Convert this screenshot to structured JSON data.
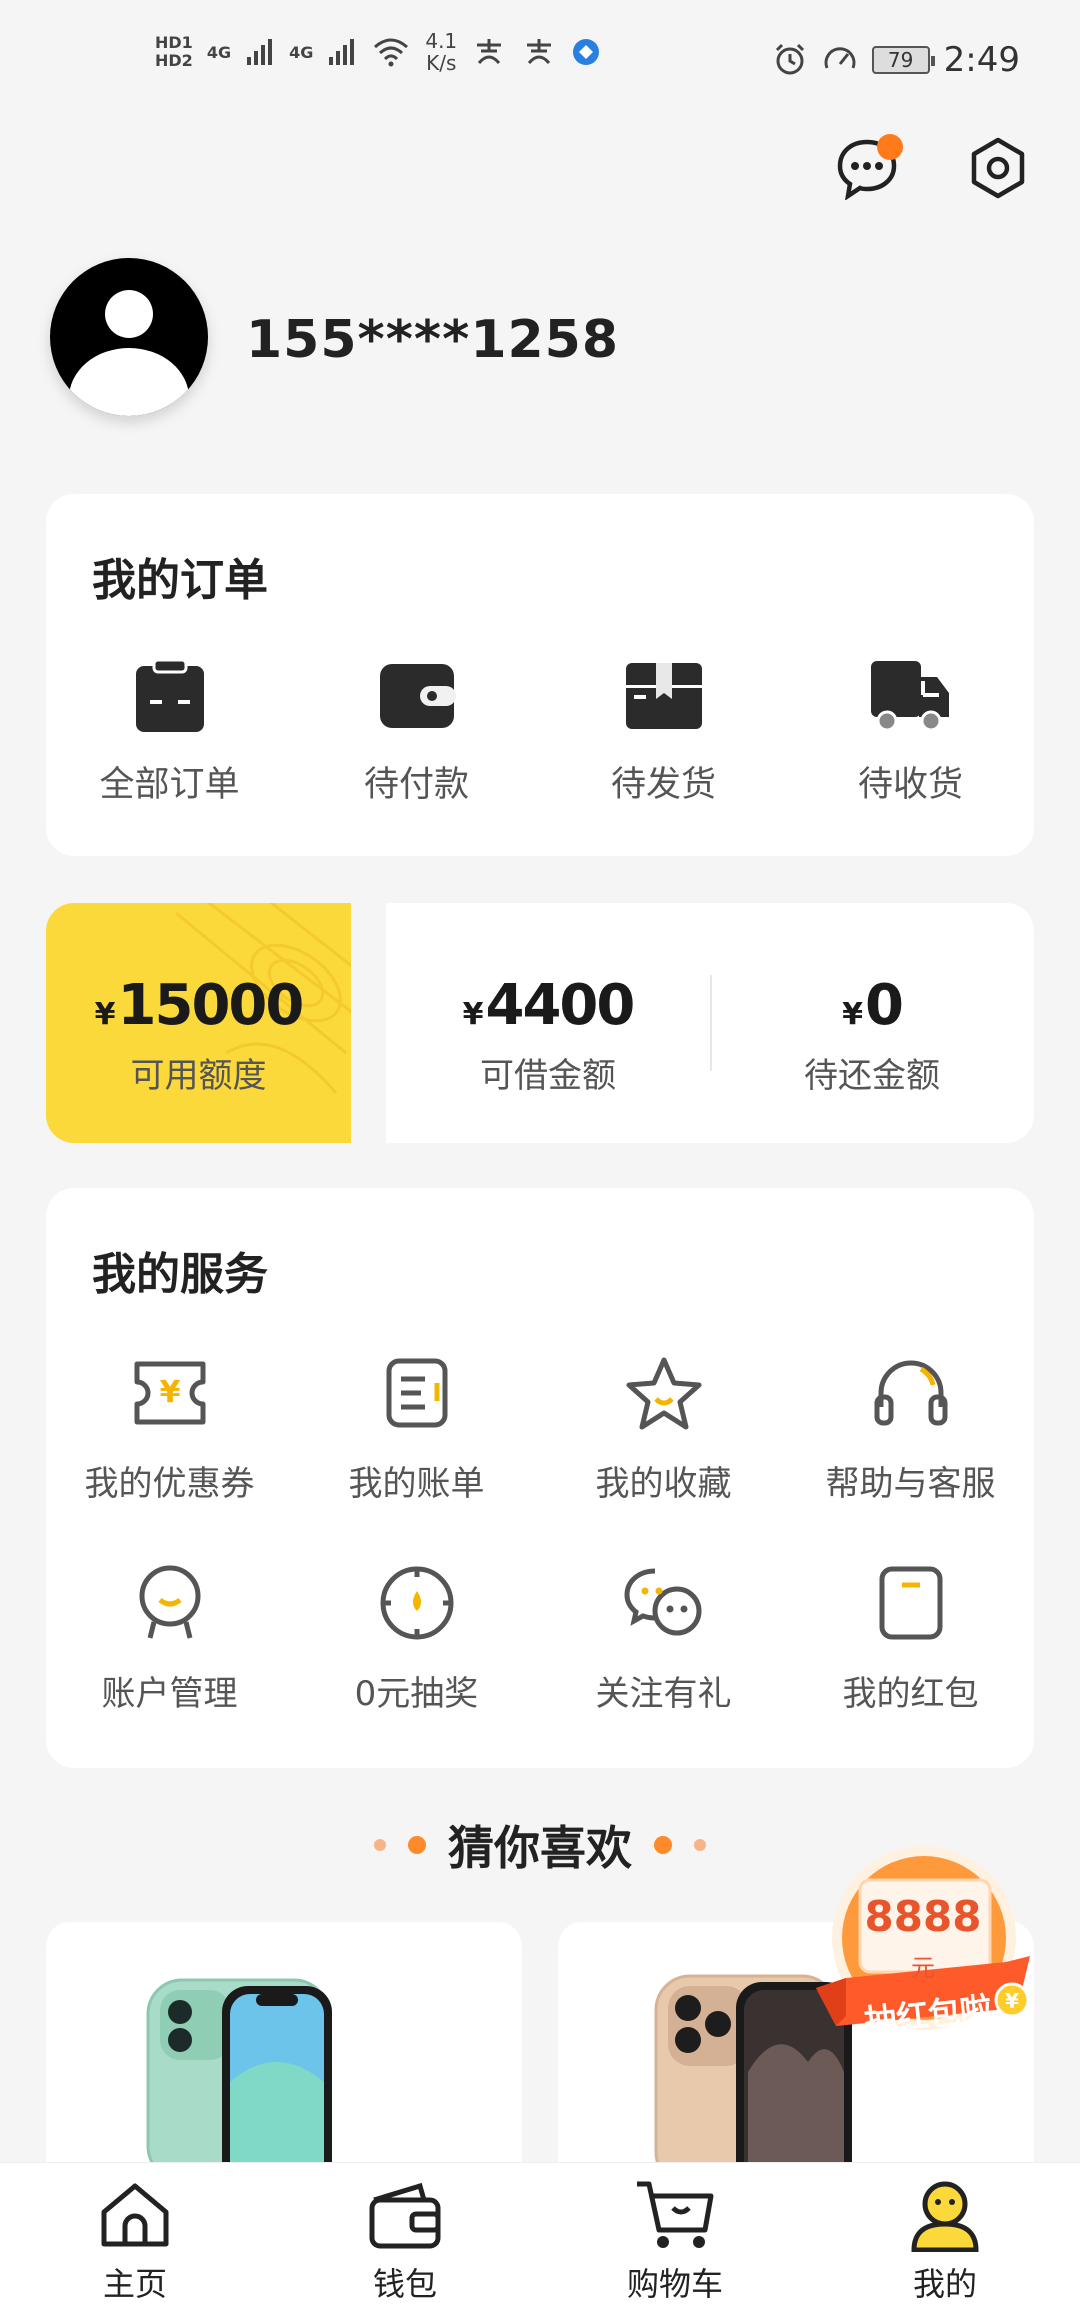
{
  "status_bar": {
    "hd1": "HD1",
    "hd2": "HD2",
    "net1": "4G",
    "net2": "4G",
    "speed_value": "4.1",
    "speed_unit": "K/s",
    "battery": "79",
    "time": "2:49"
  },
  "profile": {
    "phone": "155****1258"
  },
  "orders": {
    "title": "我的订单",
    "items": [
      {
        "label": "全部订单",
        "icon": "clipboard-icon"
      },
      {
        "label": "待付款",
        "icon": "wallet-icon"
      },
      {
        "label": "待发货",
        "icon": "package-icon"
      },
      {
        "label": "待收货",
        "icon": "truck-icon"
      }
    ]
  },
  "finance": {
    "yen": "¥",
    "credit": {
      "amount": "15000",
      "label": "可用额度"
    },
    "borrowable": {
      "amount": "4400",
      "label": "可借金额"
    },
    "repay": {
      "amount": "0",
      "label": "待还金额"
    }
  },
  "services": {
    "title": "我的服务",
    "row1": [
      {
        "label": "我的优惠券",
        "icon": "coupon-icon"
      },
      {
        "label": "我的账单",
        "icon": "bill-icon"
      },
      {
        "label": "我的收藏",
        "icon": "star-icon"
      },
      {
        "label": "帮助与客服",
        "icon": "headset-icon"
      }
    ],
    "row2": [
      {
        "label": "账户管理",
        "icon": "account-icon"
      },
      {
        "label": "0元抽奖",
        "icon": "lottery-icon"
      },
      {
        "label": "关注有礼",
        "icon": "wechat-icon"
      },
      {
        "label": "我的红包",
        "icon": "red-envelope-icon"
      }
    ]
  },
  "recommend": {
    "title": "猜你喜欢"
  },
  "red_packet": {
    "amount": "8888",
    "unit": "元",
    "banner": "抽红包啦"
  },
  "nav": {
    "items": [
      {
        "label": "主页",
        "icon": "home-icon"
      },
      {
        "label": "钱包",
        "icon": "wallet-icon"
      },
      {
        "label": "购物车",
        "icon": "cart-icon"
      },
      {
        "label": "我的",
        "icon": "profile-icon"
      }
    ]
  },
  "colors": {
    "accent_yellow": "#fcd93a",
    "accent_orange": "#ff8a2a",
    "icon_dark": "#333333"
  }
}
